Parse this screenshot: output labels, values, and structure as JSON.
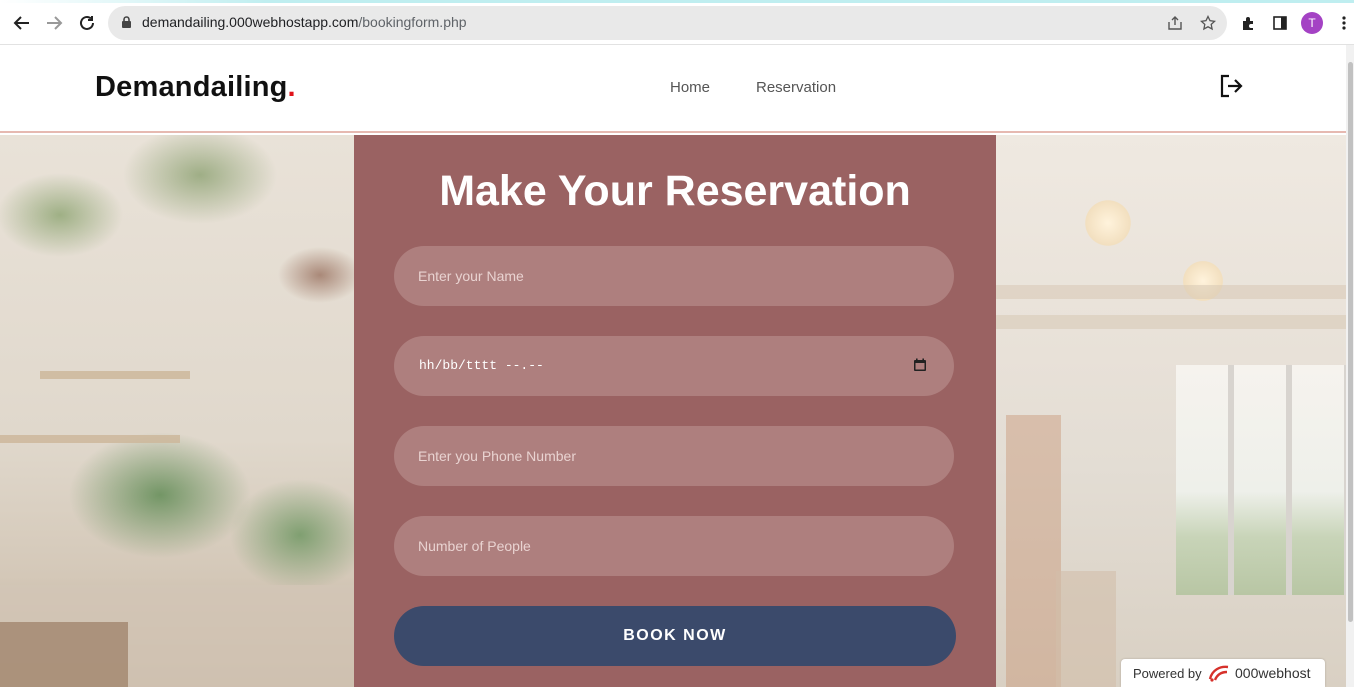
{
  "browser": {
    "url_host": "demandailing.000webhostapp.com",
    "url_path": "/bookingform.php",
    "profile_initial": "T",
    "icons": [
      "back-icon",
      "forward-icon",
      "reload-icon",
      "lock-icon",
      "share-icon",
      "star-icon",
      "extensions-icon",
      "side-panel-icon",
      "more-icon"
    ]
  },
  "site": {
    "logo_text": "Demandailing",
    "logo_dot": ".",
    "nav": [
      {
        "label": "Home"
      },
      {
        "label": "Reservation"
      }
    ],
    "logout_icon": "logout-icon"
  },
  "form": {
    "title": "Make Your Reservation",
    "name_placeholder": "Enter your Name",
    "date_value": "hh/bb/tttt --.--",
    "phone_placeholder": "Enter you Phone Number",
    "people_placeholder": "Number of People",
    "submit_label": "BOOK NOW"
  },
  "badge": {
    "label": "Powered by",
    "brand": "000webhost"
  },
  "colors": {
    "form_panel": "#9a6262",
    "field_bg": "#ae7f7e",
    "button_bg": "#3b4a6b",
    "logo_dot": "#e0131b"
  }
}
